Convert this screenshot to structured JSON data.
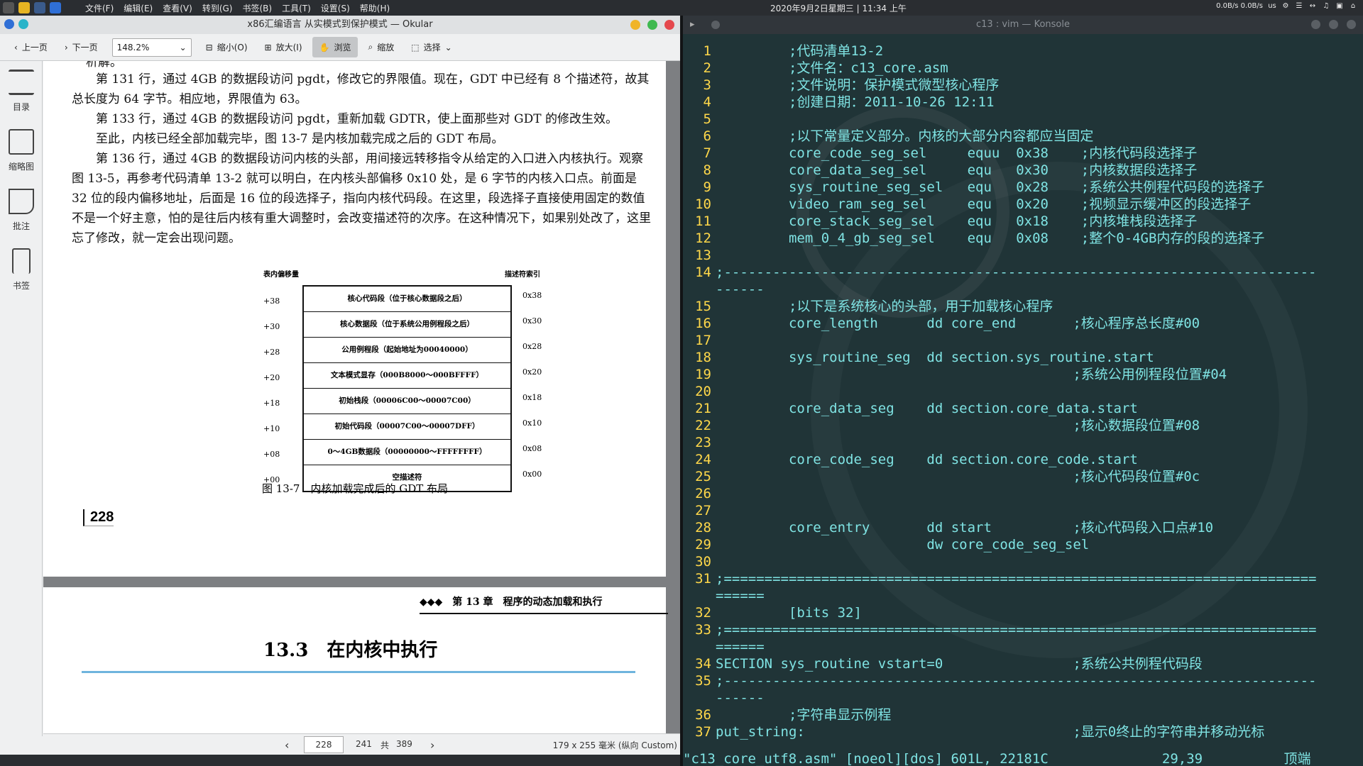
{
  "topbar": {
    "menu": [
      "文件(F)",
      "编辑(E)",
      "查看(V)",
      "转到(G)",
      "书签(B)",
      "工具(T)",
      "设置(S)",
      "帮助(H)"
    ],
    "clock": "2020年9月2日星期三 | 11:34 上午",
    "tray": [
      "0.0B/s 0.0B/s",
      "us",
      "⚙",
      "☰",
      "↔",
      "♫",
      "▣",
      "⌂"
    ]
  },
  "okular": {
    "title": "x86汇编语言 从实模式到保护模式 — Okular",
    "toolbar": {
      "prev": "上一页",
      "next": "下一页",
      "zoom": "148.2%",
      "zoom_out": "缩小(O)",
      "zoom_in": "放大(I)",
      "browse": "浏览",
      "zoom_tool": "缩放",
      "select": "选择"
    },
    "sidebar": [
      "目录",
      "缩略图",
      "批注",
      "书签"
    ],
    "page1": {
      "top_fragment": "析解。",
      "para1": "第 131 行，通过 4GB 的数据段访问 pgdt，修改它的界限值。现在，GDT 中已经有 8 个描述符，故其总长度为 64 字节。相应地，界限值为 63。",
      "para2": "第 133 行，通过 4GB 的数据段访问 pgdt，重新加载 GDTR，使上面那些对 GDT 的修改生效。",
      "para3": "至此，内核已经全部加载完毕，图 13-7 是内核加载完成之后的 GDT 布局。",
      "para4": "第 136 行，通过 4GB 的数据段访问内核的头部，用间接远转移指令从给定的入口进入内核执行。观察图 13-5，再参考代码清单 13-2 就可以明白，在内核头部偏移 0x10 处，是 6 字节的内核入口点。前面是 32 位的段内偏移地址，后面是 16 位的段选择子，指向内核代码段。在这里，段选择子直接使用固定的数值不是一个好主意，怕的是往后内核有重大调整时，会改变描述符的次序。在这种情况下，如果别处改了，这里忘了修改，就一定会出现问题。",
      "figure": {
        "left_header": "表内偏移量",
        "right_header": "描述符索引",
        "rows": [
          {
            "off": "+38",
            "label": "核心代码段（位于核心数据段之后）",
            "idx": "0x38"
          },
          {
            "off": "+30",
            "label": "核心数据段（位于系统公用例程段之后）",
            "idx": "0x30"
          },
          {
            "off": "+28",
            "label": "公用例程段（起始地址为00040000）",
            "idx": "0x28"
          },
          {
            "off": "+20",
            "label": "文本模式显存（000B8000～000BFFFF）",
            "idx": "0x20"
          },
          {
            "off": "+18",
            "label": "初始栈段（00006C00～00007C00）",
            "idx": "0x18"
          },
          {
            "off": "+10",
            "label": "初始代码段（00007C00～00007DFF）",
            "idx": "0x10"
          },
          {
            "off": "+08",
            "label": "0～4GB数据段（00000000～FFFFFFFF）",
            "idx": "0x08"
          },
          {
            "off": "+00",
            "label": "空描述符",
            "idx": "0x00"
          }
        ],
        "caption": "图 13-7　内核加载完成后的 GDT 布局"
      },
      "page_number": "228"
    },
    "page2": {
      "header": "◆◆◆　第 13 章　程序的动态加载和执行",
      "section": "13.3　在内核中执行"
    },
    "status": {
      "current_page": "228",
      "label_page": "241",
      "label_of": "共",
      "total": "389",
      "size": "179 x 255 毫米 (纵向 Custom)"
    }
  },
  "konsole": {
    "title": "c13 : vim — Konsole",
    "lines": [
      {
        "n": "1",
        "t": "         ;代码清单13-2"
      },
      {
        "n": "2",
        "t": "         ;文件名：c13_core.asm"
      },
      {
        "n": "3",
        "t": "         ;文件说明：保护模式微型核心程序"
      },
      {
        "n": "4",
        "t": "         ;创建日期：2011-10-26 12:11"
      },
      {
        "n": "5",
        "t": ""
      },
      {
        "n": "6",
        "t": "         ;以下常量定义部分。内核的大部分内容都应当固定"
      },
      {
        "n": "7",
        "t": "         core_code_seg_sel     equu  0x38    ;内核代码段选择子"
      },
      {
        "n": "8",
        "t": "         core_data_seg_sel     equ   0x30    ;内核数据段选择子"
      },
      {
        "n": "9",
        "t": "         sys_routine_seg_sel   equ   0x28    ;系统公共例程代码段的选择子"
      },
      {
        "n": "10",
        "t": "         video_ram_seg_sel     equ   0x20    ;视频显示缓冲区的段选择子"
      },
      {
        "n": "11",
        "t": "         core_stack_seg_sel    equ   0x18    ;内核堆栈段选择子"
      },
      {
        "n": "12",
        "t": "         mem_0_4_gb_seg_sel    equ   0x08    ;整个0-4GB内存的段的选择子"
      },
      {
        "n": "13",
        "t": ""
      },
      {
        "n": "14",
        "t": ";-------------------------------------------------------------------------"
      },
      {
        "n": "",
        "t": "------"
      },
      {
        "n": "15",
        "t": "         ;以下是系统核心的头部，用于加载核心程序"
      },
      {
        "n": "16",
        "t": "         core_length      dd core_end       ;核心程序总长度#00"
      },
      {
        "n": "17",
        "t": ""
      },
      {
        "n": "18",
        "t": "         sys_routine_seg  dd section.sys_routine.start"
      },
      {
        "n": "19",
        "t": "                                            ;系统公用例程段位置#04"
      },
      {
        "n": "20",
        "t": ""
      },
      {
        "n": "21",
        "t": "         core_data_seg    dd section.core_data.start"
      },
      {
        "n": "22",
        "t": "                                            ;核心数据段位置#08"
      },
      {
        "n": "23",
        "t": ""
      },
      {
        "n": "24",
        "t": "         core_code_seg    dd section.core_code.start"
      },
      {
        "n": "25",
        "t": "                                            ;核心代码段位置#0c"
      },
      {
        "n": "26",
        "t": ""
      },
      {
        "n": "27",
        "t": ""
      },
      {
        "n": "28",
        "t": "         core_entry       dd start          ;核心代码段入口点#10"
      },
      {
        "n": "29",
        "t": "                          dw core_code_seg_sel"
      },
      {
        "n": "30",
        "t": ""
      },
      {
        "n": "31",
        "t": ";========================================================================="
      },
      {
        "n": "",
        "t": "======"
      },
      {
        "n": "32",
        "t": "         [bits 32]"
      },
      {
        "n": "33",
        "t": ";========================================================================="
      },
      {
        "n": "",
        "t": "======"
      },
      {
        "n": "34",
        "t": "SECTION sys_routine vstart=0                ;系统公共例程代码段"
      },
      {
        "n": "35",
        "t": ";-------------------------------------------------------------------------"
      },
      {
        "n": "",
        "t": "------"
      },
      {
        "n": "36",
        "t": "         ;字符串显示例程"
      },
      {
        "n": "37",
        "t": "put_string:                                 ;显示0终止的字符串并移动光标"
      }
    ],
    "status": "\"c13_core_utf8.asm\" [noeol][dos] 601L, 22181C              29,39          顶端"
  }
}
